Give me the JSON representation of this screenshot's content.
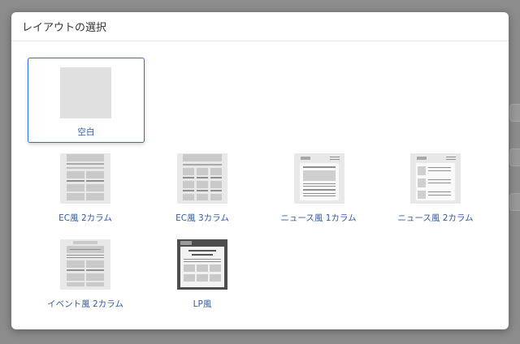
{
  "modal": {
    "title": "レイアウトの選択"
  },
  "layouts": [
    {
      "label": "空白",
      "thumb": "blank"
    },
    {
      "label": "EC風 2カラム",
      "thumb": "ec-2col"
    },
    {
      "label": "EC風 3カラム",
      "thumb": "ec-3col"
    },
    {
      "label": "ニュース風 1カラム",
      "thumb": "news-1col"
    },
    {
      "label": "ニュース風 2カラム",
      "thumb": "news-2col"
    },
    {
      "label": "イベント風 2カラム",
      "thumb": "event-2col"
    },
    {
      "label": "LP風",
      "thumb": "lp"
    }
  ],
  "selected": "空白",
  "colors": {
    "accent": "#2a6fd6",
    "label": "#2f5aa6",
    "thumbBg": "#e0e0e0"
  }
}
